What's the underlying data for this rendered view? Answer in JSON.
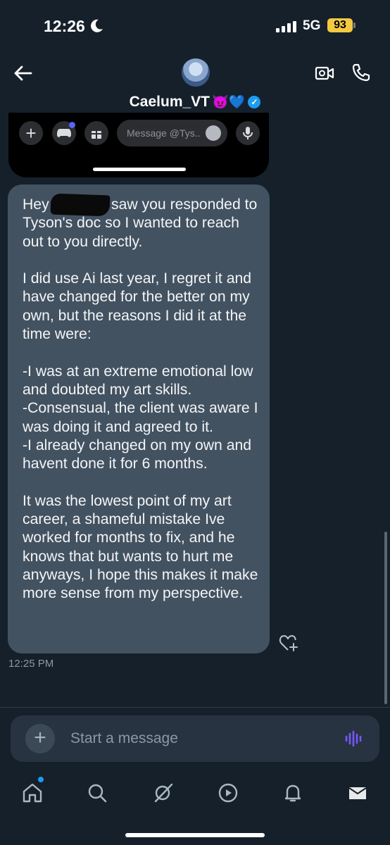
{
  "status_bar": {
    "time": "12:26",
    "network": "5G",
    "battery": "93"
  },
  "header": {
    "title": "Caelum_VT",
    "title_emoji": "😈💙"
  },
  "embedded_screenshot": {
    "message_placeholder": "Message @Tys.."
  },
  "message": {
    "text": "Hey             ! saw you responded to Tyson's doc so I wanted to reach out to you directly.\n\nI did use Ai last year, I regret it and have changed for the better on my own, but the reasons I did it at the time were:\n\n-I was at an extreme emotional low and doubted my art skills.\n-Consensual, the client was aware I was doing it and agreed to it.\n-I already changed on my own and havent done it for 6 months.\n\nIt was the lowest point of my art career, a shameful mistake Ive worked for months to fix, and he knows that but wants to hurt me anyways, I hope this makes it make more sense from my perspective.",
    "timestamp": "12:25 PM"
  },
  "composer": {
    "placeholder": "Start a message"
  },
  "colors": {
    "background": "#15202b",
    "bubble": "#435261",
    "accent": "#1d9bf0",
    "voice": "#7856ff"
  },
  "icons": [
    "moon-icon",
    "signal-icon",
    "back-arrow-icon",
    "video-call-icon",
    "phone-icon",
    "verified-icon",
    "heart-plus-icon",
    "add-icon",
    "voice-wave-icon",
    "home-icon",
    "search-icon",
    "grok-icon",
    "video-icon",
    "notifications-icon",
    "messages-icon"
  ]
}
